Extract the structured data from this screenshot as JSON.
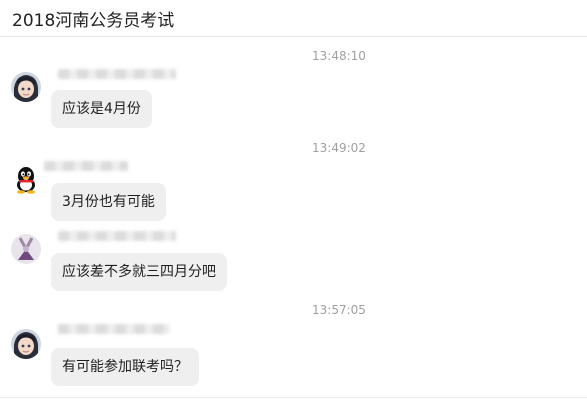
{
  "header": {
    "title": "2018河南公务员考试"
  },
  "messages": [
    {
      "timestamp": "13:48:10",
      "avatar_icon": "anime-avatar-icon",
      "text": "应该是4月份"
    },
    {
      "timestamp": "13:49:02",
      "avatar_icon": "qq-penguin-icon",
      "text": "3月份也有可能"
    },
    {
      "timestamp": "",
      "avatar_icon": "figure-avatar-icon",
      "text": "应该差不多就三四月分吧"
    },
    {
      "timestamp": "13:57:05",
      "avatar_icon": "anime-avatar-icon",
      "text": "有可能参加联考吗？"
    }
  ],
  "colors": {
    "bubble": "#efefef",
    "timestamp": "#a0a0a0",
    "text": "#1f1f1f"
  }
}
